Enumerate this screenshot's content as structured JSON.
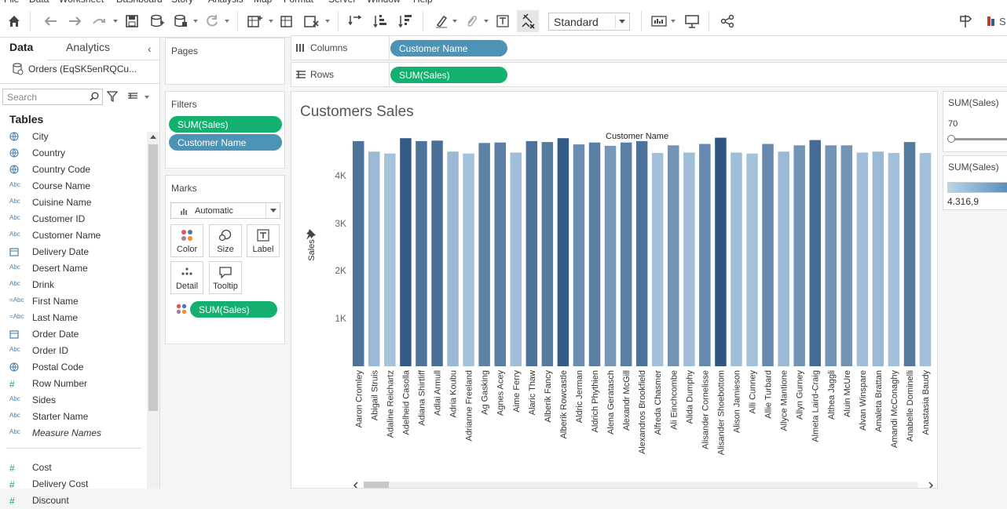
{
  "menu": [
    "File",
    "Data",
    "Worksheet",
    "Dashboard",
    "Story",
    "Analysis",
    "Map",
    "Format",
    "Server",
    "Window",
    "Help"
  ],
  "toolbar": {
    "fit": "Standard"
  },
  "data_pane": {
    "tab_data": "Data",
    "tab_analytics": "Analytics",
    "datasource": "Orders (EqSK5enRQCu...",
    "search_placeholder": "Search",
    "tables_heading": "Tables",
    "fields": [
      {
        "icon": "globe",
        "name": "City"
      },
      {
        "icon": "globe",
        "name": "Country"
      },
      {
        "icon": "globe",
        "name": "Country Code"
      },
      {
        "icon": "Abc",
        "name": "Course Name"
      },
      {
        "icon": "Abc",
        "name": "Cuisine Name"
      },
      {
        "icon": "Abc",
        "name": "Customer ID"
      },
      {
        "icon": "Abc",
        "name": "Customer Name"
      },
      {
        "icon": "calendar",
        "name": "Delivery Date"
      },
      {
        "icon": "Abc",
        "name": "Desert Name"
      },
      {
        "icon": "Abc",
        "name": "Drink"
      },
      {
        "icon": "=Abc",
        "name": "First Name"
      },
      {
        "icon": "=Abc",
        "name": "Last Name"
      },
      {
        "icon": "calendar",
        "name": "Order Date"
      },
      {
        "icon": "Abc",
        "name": "Order ID"
      },
      {
        "icon": "globe",
        "name": "Postal Code"
      },
      {
        "icon": "#",
        "name": "Row Number"
      },
      {
        "icon": "Abc",
        "name": "Sides"
      },
      {
        "icon": "Abc",
        "name": "Starter Name"
      },
      {
        "icon": "Abc",
        "name": "Measure Names",
        "italic": true
      }
    ],
    "measures": [
      {
        "icon": "#",
        "name": "Cost"
      },
      {
        "icon": "#",
        "name": "Delivery Cost"
      },
      {
        "icon": "#",
        "name": "Discount"
      }
    ]
  },
  "pages": {
    "title": "Pages"
  },
  "filters": {
    "title": "Filters",
    "pills": [
      "SUM(Sales)",
      "Customer Name"
    ]
  },
  "marks": {
    "title": "Marks",
    "type": "Automatic",
    "buttons": [
      "Color",
      "Size",
      "Label",
      "Detail",
      "Tooltip"
    ],
    "pill": "SUM(Sales)"
  },
  "columns": {
    "label": "Columns",
    "pill": "Customer Name"
  },
  "rows": {
    "label": "Rows",
    "pill": "SUM(Sales)"
  },
  "legend_filter": {
    "title": "SUM(Sales)",
    "value": "70"
  },
  "legend_color": {
    "title": "SUM(Sales)",
    "value": "4.316,9"
  },
  "chart_data": {
    "type": "bar",
    "title": "Customers Sales",
    "column_header": "Customer Name",
    "ylabel": "Sales",
    "ylim": [
      0,
      4800
    ],
    "yticks": [
      "1K",
      "2K",
      "3K",
      "4K"
    ],
    "ytick_values": [
      1000,
      2000,
      3000,
      4000
    ],
    "categories": [
      "Aaron Cromley",
      "Abigail Struis",
      "Adaline Reichartz",
      "Adelheid Casolla",
      "Adiana Shirtliff",
      "Adlai Armull",
      "Adria Koubu",
      "Adrianne Freeland",
      "Ag Gasking",
      "Agnes Acey",
      "Aime Ferry",
      "Alaric Thaw",
      "Alberik Fancy",
      "Alberik Rowcastle",
      "Aldric Jerman",
      "Aldrich Phythien",
      "Alena Geratasch",
      "Alexandr McGill",
      "Alexandros Brookfield",
      "Alfreda Chasmer",
      "Ali Einchcombe",
      "Alida Dumphy",
      "Alisander Cornelisse",
      "Alisander Shoebottom",
      "Alison Jamieson",
      "Alli Cunney",
      "Allie Turbard",
      "Allyce Mantione",
      "Allyn Gurney",
      "Almeta Laird-Craig",
      "Althea Jaggli",
      "Aluin McUre",
      "Alvan Winspare",
      "Amaleta Brattan",
      "Amandi McConaghy",
      "Anabelle Dominelli",
      "Anastasia Baudy"
    ],
    "values": [
      4720,
      4500,
      4460,
      4780,
      4720,
      4730,
      4500,
      4460,
      4680,
      4690,
      4480,
      4720,
      4700,
      4780,
      4650,
      4690,
      4620,
      4690,
      4720,
      4470,
      4630,
      4480,
      4660,
      4790,
      4480,
      4460,
      4660,
      4500,
      4630,
      4740,
      4630,
      4630,
      4480,
      4500,
      4470,
      4700,
      4470
    ],
    "color_min": 4316.9,
    "color_max": 4800
  }
}
